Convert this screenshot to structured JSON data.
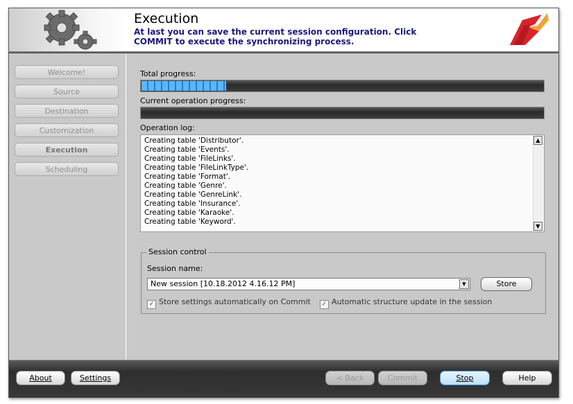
{
  "header": {
    "title": "Execution",
    "subtitle": "At last you can save the current session configuration. Click COMMIT to execute the synchronizing process."
  },
  "sidebar": {
    "items": [
      {
        "label": "Welcome!"
      },
      {
        "label": "Source"
      },
      {
        "label": "Destination"
      },
      {
        "label": "Customization"
      },
      {
        "label": "Execution"
      },
      {
        "label": "Scheduling"
      }
    ]
  },
  "progress": {
    "total_label": "Total progress:",
    "total_fraction": 0.21,
    "current_label": "Current operation progress:",
    "current_fraction": 0.0
  },
  "log": {
    "label": "Operation log:",
    "lines": [
      "Creating table 'Distributor'.",
      "Creating table 'Events'.",
      "Creating table 'FileLinks'.",
      "Creating table 'FileLinkType'.",
      "Creating table 'Format'.",
      "Creating table 'Genre'.",
      "Creating table 'GenreLink'.",
      "Creating table 'Insurance'.",
      "Creating table 'Karaoke'.",
      "Creating table 'Keyword'."
    ]
  },
  "session": {
    "group_label": "Session control",
    "name_label": "Session name:",
    "name_value": "New session [10.18.2012 4.16.12 PM]",
    "store_label": "Store",
    "check1_label": "Store settings automatically on Commit",
    "check2_label": "Automatic structure update in the session"
  },
  "footer": {
    "about": "About",
    "settings": "Settings",
    "back": "< Back",
    "commit": "Commit",
    "stop": "Stop",
    "help": "Help"
  },
  "colors": {
    "accent": "#1a1a7e",
    "progress": "#2a78d4"
  }
}
